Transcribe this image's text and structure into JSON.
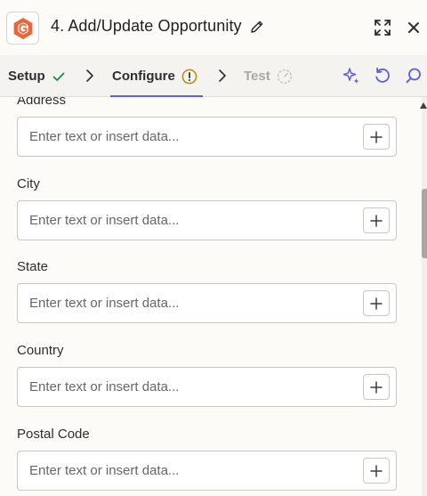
{
  "header": {
    "title": "4. Add/Update Opportunity",
    "app_icon": "app-logo-icon",
    "edit_icon": "pencil-icon",
    "expand_icon": "expand-icon",
    "close_icon": "close-icon"
  },
  "tabs": [
    {
      "label": "Setup",
      "status": "complete",
      "icon": "check-icon"
    },
    {
      "label": "Configure",
      "status": "warning",
      "icon": "alert-circle-icon"
    },
    {
      "label": "Test",
      "status": "disabled",
      "icon": "timer-icon"
    }
  ],
  "toolbar": {
    "ai_icon": "sparkle-icon",
    "undo_icon": "undo-icon",
    "search_icon": "search-icon"
  },
  "colors": {
    "accent": "#5f5fd8",
    "brand_orange": "#e8673a",
    "success": "#1f8a4a",
    "warning": "#b8860b",
    "disabled": "#a9a8a4"
  },
  "fields": [
    {
      "label": "Address",
      "placeholder": "Enter text or insert data...",
      "value": ""
    },
    {
      "label": "City",
      "placeholder": "Enter text or insert data...",
      "value": ""
    },
    {
      "label": "State",
      "placeholder": "Enter text or insert data...",
      "value": ""
    },
    {
      "label": "Country",
      "placeholder": "Enter text or insert data...",
      "value": ""
    },
    {
      "label": "Postal Code",
      "placeholder": "Enter text or insert data...",
      "value": ""
    }
  ]
}
